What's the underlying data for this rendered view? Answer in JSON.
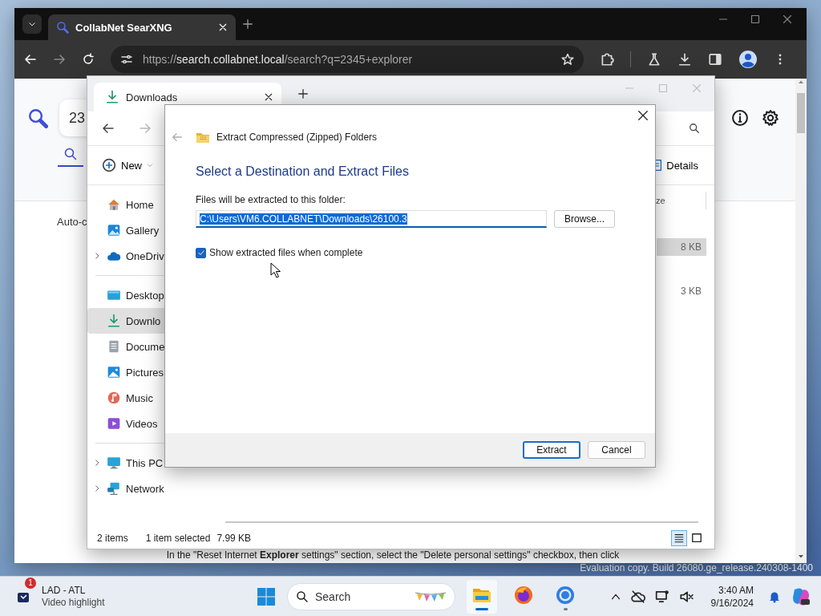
{
  "desktop": {
    "watermark": "Evaluation copy. Build 26080.ge_release.240308-1400"
  },
  "browser": {
    "tabs": [
      {
        "title": "CollabNet SearXNG",
        "selected": true
      }
    ],
    "url": {
      "scheme": "https://",
      "host": "search.collabnet.local",
      "path": "/search?q=2345+explorer"
    },
    "page": {
      "search_query": "23",
      "category_tab": {
        "selected": true
      },
      "autocomplete_label": "Auto-c",
      "instruction": "In the \"Reset Internet **Explorer** settings\" section, select the \"Delete personal settings\" checkbox, then click"
    }
  },
  "explorer": {
    "tabs": [
      {
        "title": "Downloads",
        "selected": true
      }
    ],
    "new_label": "New",
    "details_label": "Details",
    "column_header": "ze",
    "rows": [
      {
        "size": "8 KB",
        "selected": true
      },
      {
        "size": "3 KB",
        "selected": false
      }
    ],
    "sidebar": [
      [
        {
          "kind": "home",
          "name": "Home",
          "expandable": false,
          "selected": false
        },
        {
          "kind": "gallery",
          "name": "Gallery",
          "expandable": false,
          "selected": false
        },
        {
          "kind": "cloud",
          "name": "OneDriv",
          "expandable": true,
          "selected": false
        }
      ],
      [
        {
          "kind": "desktop",
          "name": "Desktop",
          "expandable": false,
          "selected": false
        },
        {
          "kind": "download",
          "name": "Downlo",
          "expandable": false,
          "selected": true
        },
        {
          "kind": "document",
          "name": "Docume",
          "expandable": false,
          "selected": false
        },
        {
          "kind": "pictures",
          "name": "Pictures",
          "expandable": false,
          "selected": false
        },
        {
          "kind": "music",
          "name": "Music",
          "expandable": false,
          "selected": false
        },
        {
          "kind": "videos",
          "name": "Videos",
          "expandable": false,
          "selected": false
        }
      ],
      [
        {
          "kind": "pc",
          "name": "This PC",
          "expandable": true,
          "selected": false
        },
        {
          "kind": "network",
          "name": "Network",
          "expandable": true,
          "selected": false
        }
      ]
    ],
    "status": {
      "count": "2 items",
      "selection": "1 item selected",
      "size": "7.99 KB"
    },
    "views": [
      {
        "kind": "details",
        "selected": true
      },
      {
        "kind": "tiles",
        "selected": false
      }
    ]
  },
  "dialog": {
    "title": "Extract Compressed (Zipped) Folders",
    "heading": "Select a Destination and Extract Files",
    "label": "Files will be extracted to this folder:",
    "path": "C:\\Users\\VM6.COLLABNET\\Downloads\\26100.3",
    "browse": "Browse...",
    "checkbox": {
      "label": "Show extracted files when complete",
      "checked": true
    },
    "buttons": [
      {
        "label": "Extract",
        "default": true
      },
      {
        "label": "Cancel",
        "default": false
      }
    ]
  },
  "taskbar": {
    "widget": {
      "title": "LAD - ATL",
      "subtitle": "Video highlight",
      "badge": "1"
    },
    "search_placeholder": "Search",
    "apps": [
      {
        "kind": "explorer",
        "running": true,
        "focused": true
      },
      {
        "kind": "firefox",
        "running": false,
        "focused": false
      },
      {
        "kind": "chrome",
        "running": true,
        "focused": false
      }
    ],
    "clock": {
      "time": "3:40 AM",
      "date": "9/16/2024"
    }
  }
}
